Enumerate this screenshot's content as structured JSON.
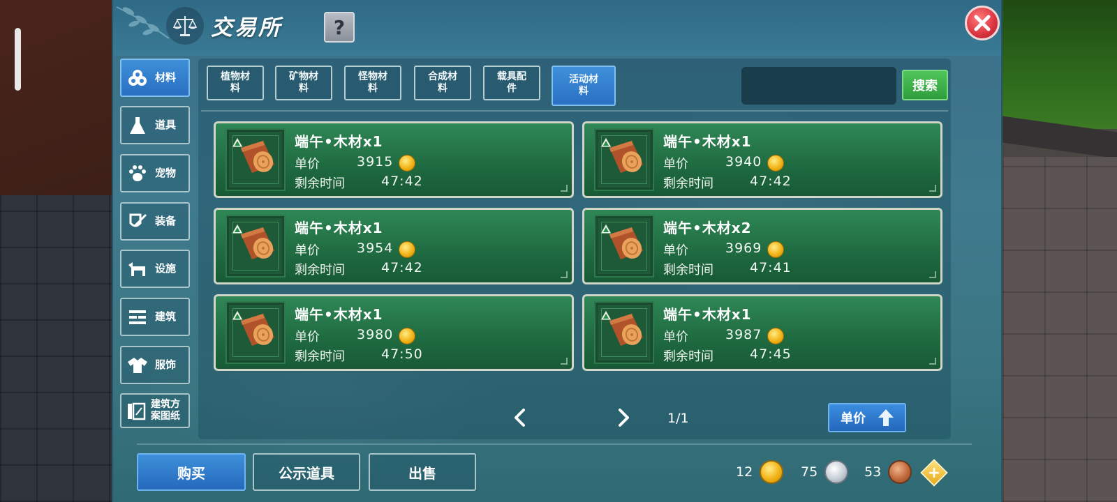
{
  "window": {
    "title": "交易所",
    "help_label": "?",
    "close_label": "×"
  },
  "sidebar": {
    "items": [
      {
        "label": "材料",
        "icon": "materials-icon",
        "active": true
      },
      {
        "label": "道具",
        "icon": "flask-icon",
        "active": false
      },
      {
        "label": "宠物",
        "icon": "paw-icon",
        "active": false
      },
      {
        "label": "装备",
        "icon": "equipment-icon",
        "active": false
      },
      {
        "label": "设施",
        "icon": "facility-icon",
        "active": false
      },
      {
        "label": "建筑",
        "icon": "building-icon",
        "active": false
      },
      {
        "label": "服饰",
        "icon": "clothing-icon",
        "active": false
      },
      {
        "label": "建筑方\n案图纸",
        "icon": "blueprint-icon",
        "active": false
      }
    ]
  },
  "categories": {
    "tabs": [
      {
        "label": "植物材\n料",
        "active": false
      },
      {
        "label": "矿物材\n料",
        "active": false
      },
      {
        "label": "怪物材\n料",
        "active": false
      },
      {
        "label": "合成材\n料",
        "active": false
      },
      {
        "label": "载具配\n件",
        "active": false
      },
      {
        "label": "活动材\n料",
        "active": true
      }
    ]
  },
  "search": {
    "value": "",
    "placeholder": "",
    "button_label": "搜索"
  },
  "listing_labels": {
    "price": "单价",
    "time": "剩余时间"
  },
  "listings": [
    {
      "name": "端午•木材x1",
      "price": "3915",
      "time": "47:42"
    },
    {
      "name": "端午•木材x1",
      "price": "3940",
      "time": "47:42"
    },
    {
      "name": "端午•木材x1",
      "price": "3954",
      "time": "47:42"
    },
    {
      "name": "端午•木材x2",
      "price": "3969",
      "time": "47:41"
    },
    {
      "name": "端午•木材x1",
      "price": "3980",
      "time": "47:50"
    },
    {
      "name": "端午•木材x1",
      "price": "3987",
      "time": "47:45"
    }
  ],
  "pagination": {
    "page": "1/1"
  },
  "sort": {
    "label": "单价",
    "icon": "sort-up-icon"
  },
  "bottom": {
    "buy_label": "购买",
    "public_items_label": "公示道具",
    "sell_label": "出售"
  },
  "currency": {
    "gold": "12",
    "silver": "75",
    "bronze": "53",
    "add_label": "+"
  },
  "colors": {
    "accent_blue": "#2a70c4",
    "listing_green": "#1f6a40",
    "search_green": "#2f9d3c",
    "close_red": "#d9333f",
    "panel_teal": "#3a6e88"
  }
}
